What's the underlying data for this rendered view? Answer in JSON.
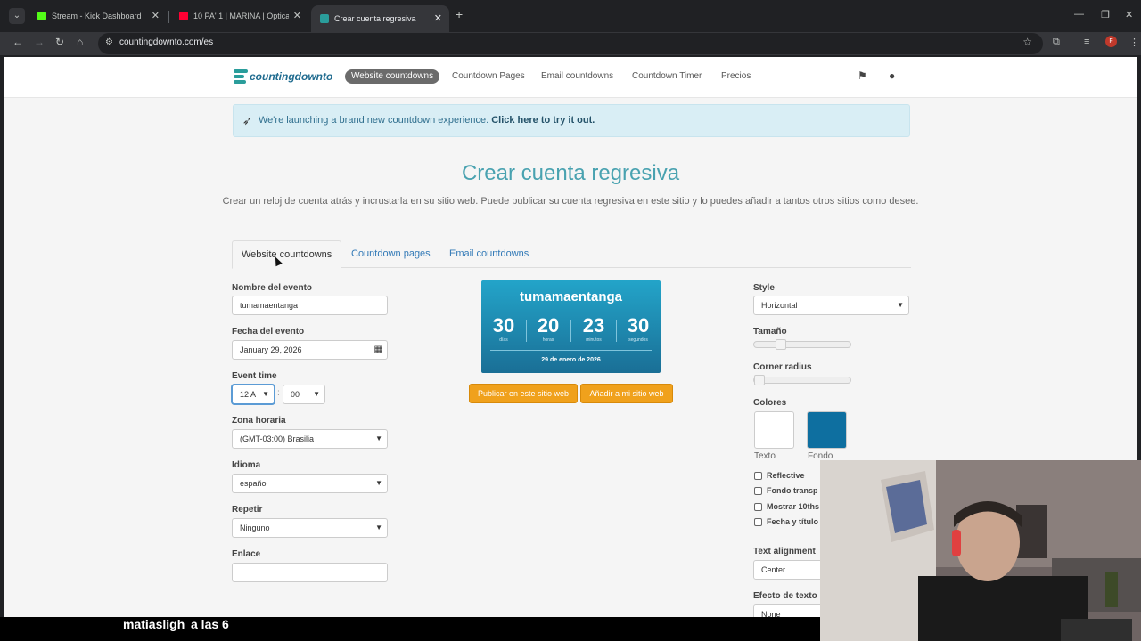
{
  "browser": {
    "tabs": [
      {
        "title": "Stream - Kick Dashboard",
        "favicon_color": "#53fc18"
      },
      {
        "title": "10 PA' 1 | MARINA | Optical - Yo",
        "favicon_color": "#ff0033"
      },
      {
        "title": "Crear cuenta regresiva",
        "favicon_color": "#2a9d9b"
      }
    ],
    "url": "countingdownto.com/es",
    "profile_initial": "F"
  },
  "header": {
    "logo": "countingdownto",
    "nav": [
      "Website countdowns",
      "Countdown Pages",
      "Email countdowns",
      "Countdown Timer",
      "Precios"
    ]
  },
  "banner": {
    "text": "We're launching a brand new countdown experience.",
    "link": "Click here to try it out."
  },
  "title": "Crear cuenta regresiva",
  "subtitle": "Crear un reloj de cuenta atrás y incrustarla en su sitio web. Puede publicar su cuenta regresiva en este sitio y lo puedes añadir a tantos otros sitios como desee.",
  "page_tabs": [
    "Website countdowns",
    "Countdown pages",
    "Email countdowns"
  ],
  "form": {
    "event_name_label": "Nombre del evento",
    "event_name": "tumamaentanga",
    "event_date_label": "Fecha del evento",
    "event_date": "January 29, 2026",
    "event_time_label": "Event time",
    "hour": "12 A",
    "minute": "00",
    "timezone_label": "Zona horaria",
    "timezone": "(GMT-03:00) Brasilia",
    "language_label": "Idioma",
    "language": "español",
    "repeat_label": "Repetir",
    "repeat": "Ninguno",
    "link_label": "Enlace",
    "link": ""
  },
  "preview": {
    "name": "tumamaentanga",
    "units": [
      {
        "value": "30",
        "label": "días"
      },
      {
        "value": "20",
        "label": "horas"
      },
      {
        "value": "23",
        "label": "minutos"
      },
      {
        "value": "30",
        "label": "segundos"
      }
    ],
    "date": "29 de enero de 2026",
    "publish_button": "Publicar en este sitio web",
    "add_button": "Añadir a mi sitio web"
  },
  "options": {
    "style_label": "Style",
    "style": "Horizontal",
    "size_label": "Tamaño",
    "size_level": 0.25,
    "radius_label": "Corner radius",
    "radius_level": 0,
    "colors_label": "Colores",
    "text_color_label": "Texto",
    "text_color": "#ffffff",
    "bg_color_label": "Fondo",
    "bg_color": "#0e6fa0",
    "checkboxes": [
      "Reflective",
      "Fondo transp",
      "Mostrar 10ths",
      "Fecha y título"
    ],
    "text_align_label": "Text alignment",
    "text_align": "Center",
    "text_effect_label": "Efecto de texto",
    "text_effect": "None"
  },
  "chat": {
    "user": "matiasligh",
    "message": "a las 6"
  }
}
